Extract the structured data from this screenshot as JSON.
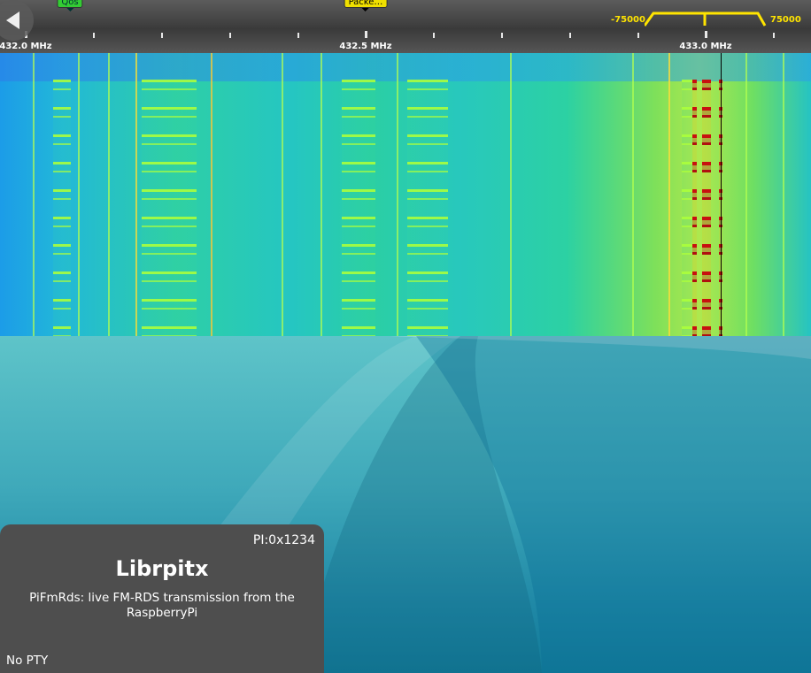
{
  "scale": {
    "frequency_labels": [
      "432.0 MHz",
      "432.5 MHz",
      "433.0 MHz"
    ],
    "bookmarks": [
      {
        "label": "Qos",
        "color": "#33cc33"
      },
      {
        "label": "Packe…",
        "color": "#f0e000"
      }
    ],
    "passband": {
      "low_label": "-75000",
      "high_label": "75000",
      "color": "#ffe400"
    }
  },
  "back_button": {
    "icon": "back-arrow-icon"
  },
  "rds": {
    "pi": "PI:0x1234",
    "ps": "Librpitx",
    "radiotext": "PiFmRds: live FM-RDS transmission from the RaspberryPi",
    "pty": "No PTY"
  },
  "colors": {
    "panel_bg": "#4e4e4e",
    "scale_bg": "#4a4a4a",
    "passband": "#ffe400",
    "desktop": "#1f88a6"
  }
}
